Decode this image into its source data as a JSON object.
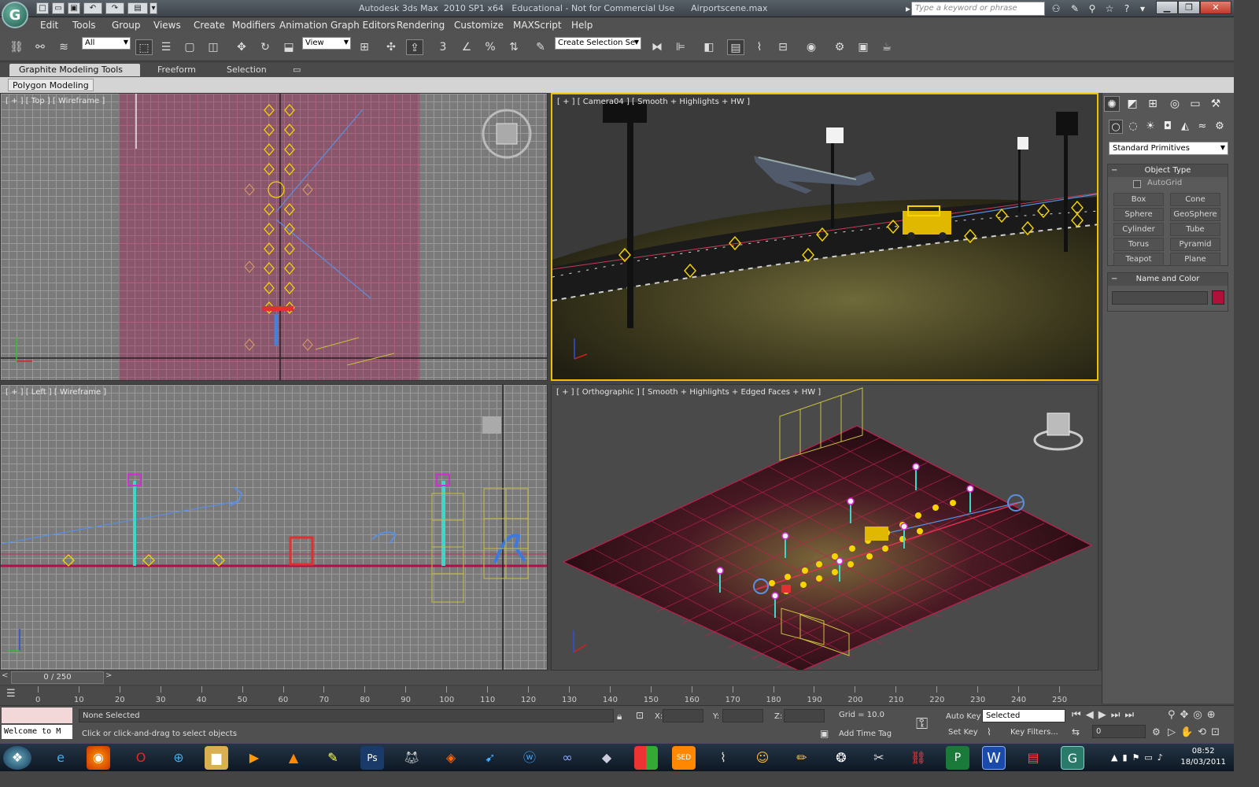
{
  "window": {
    "title": "Autodesk 3ds Max  2010 SP1 x64   Educational - Not for Commercial Use      Airportscene.max",
    "search_placeholder": "Type a keyword or phrase",
    "logo_glyph": "G"
  },
  "menubar": [
    "Edit",
    "Tools",
    "Group",
    "Views",
    "Create",
    "Modifiers",
    "Animation",
    "Graph Editors",
    "Rendering",
    "Customize",
    "MAXScript",
    "Help"
  ],
  "toolbar": {
    "filter_value": "All",
    "coord_value": "View",
    "selection_set_placeholder": "Create Selection Se",
    "snap_label": "3"
  },
  "ribbon": {
    "tabs": [
      "Graphite Modeling Tools",
      "Freeform",
      "Selection"
    ],
    "panel_button": "Polygon Modeling"
  },
  "viewports": {
    "top": "[ + ] [ Top ] [ Wireframe ]",
    "camera": "[ + ] [ Camera04 ] [ Smooth + Highlights + HW ]",
    "left": "[ + ] [ Left ] [ Wireframe ]",
    "ortho": "[ + ] [ Orthographic ] [ Smooth + Highlights + Edged Faces + HW ]"
  },
  "command_panel": {
    "category": "Standard Primitives",
    "object_type_title": "Object Type",
    "autogrid_label": "AutoGrid",
    "buttons": [
      "Box",
      "Cone",
      "Sphere",
      "GeoSphere",
      "Cylinder",
      "Tube",
      "Torus",
      "Pyramid",
      "Teapot",
      "Plane"
    ],
    "name_color_title": "Name and Color",
    "object_color": "#b0103a"
  },
  "timeline": {
    "slider_label": "0 / 250",
    "ticks": [
      "0",
      "10",
      "20",
      "30",
      "40",
      "50",
      "60",
      "70",
      "80",
      "90",
      "100",
      "110",
      "120",
      "130",
      "140",
      "150",
      "160",
      "170",
      "180",
      "190",
      "200",
      "210",
      "220",
      "230",
      "240",
      "250"
    ]
  },
  "statusbar": {
    "listener_text": "Welcome to M",
    "selection_status": "None Selected",
    "prompt": "Click or click-and-drag to select objects",
    "x_label": "X:",
    "y_label": "Y:",
    "z_label": "Z:",
    "grid": "Grid = 10.0",
    "add_time_tag": "Add Time Tag",
    "auto_key": "Auto Key",
    "set_key": "Set Key",
    "key_mode": "Selected",
    "key_filters": "Key Filters...",
    "frame_value": "0"
  },
  "taskbar": {
    "time": "08:52",
    "date": "18/03/2011"
  },
  "colors": {
    "selection_yellow": "#f5d400",
    "grid_red": "#c02050",
    "camera_blue": "#4a7fd8"
  }
}
